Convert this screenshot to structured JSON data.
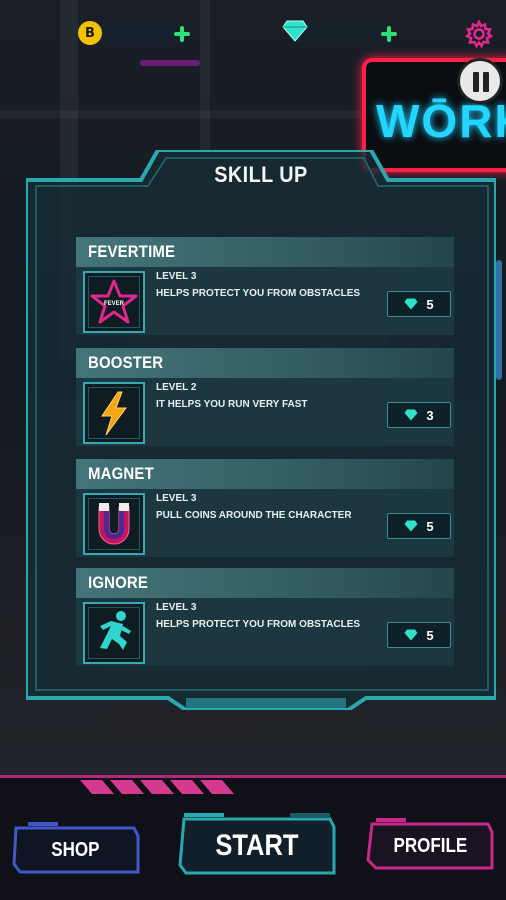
{
  "topbar": {
    "coin_symbol": "B",
    "settings_icon": "gear-icon",
    "sign_text": "WŌRK",
    "colors": {
      "coin": "#f2c200",
      "plus": "#2ee07a",
      "gear": "#e0288c",
      "gem": "#2fe3c8"
    }
  },
  "dialog": {
    "title": "SKILL UP",
    "skills": [
      {
        "name": "FEVERTIME",
        "level": "LEVEL 3",
        "description": "HELPS PROTECT YOU FROM OBSTACLES",
        "cost": "5",
        "icon": "star-icon",
        "icon_text": "FEVER"
      },
      {
        "name": "BOOSTER",
        "level": "LEVEL 2",
        "description": "IT HELPS YOU RUN VERY FAST",
        "cost": "3",
        "icon": "lightning-icon"
      },
      {
        "name": "MAGNET",
        "level": "LEVEL 3",
        "description": "PULL COINS AROUND THE CHARACTER",
        "cost": "5",
        "icon": "magnet-icon"
      },
      {
        "name": "IGNORE",
        "level": "LEVEL 3",
        "description": "HELPS PROTECT YOU FROM OBSTACLES",
        "cost": "5",
        "icon": "running-man-icon"
      }
    ]
  },
  "bottom": {
    "shop_label": "SHOP",
    "start_label": "START",
    "profile_label": "PROFILE"
  }
}
